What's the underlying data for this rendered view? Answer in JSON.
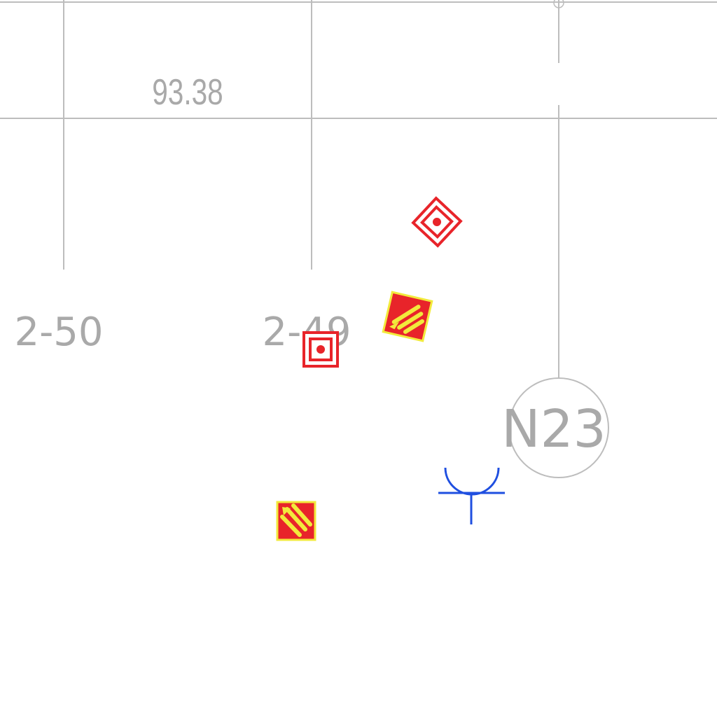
{
  "map": {
    "colors": {
      "background": "#ffffff",
      "grid_line": "#bdbdbd",
      "label_text": "#a9a9a9",
      "symbol_red": "#e8242a",
      "symbol_yellow": "#f2ea3c",
      "symbol_blue": "#1f4fe0"
    },
    "labels": {
      "elevation": "93.38",
      "parcel_left": "2-50",
      "parcel_center": "2-49",
      "node_id": "N23"
    },
    "symbols": [
      {
        "name": "red-concentric-diamond-icon",
        "kind": "target-diamond"
      },
      {
        "name": "red-concentric-square-icon",
        "kind": "target-square"
      },
      {
        "name": "red-yellow-hatched-square-icon",
        "kind": "hatched-square"
      },
      {
        "name": "red-yellow-hatched-square-icon",
        "kind": "hatched-square"
      },
      {
        "name": "blue-antenna-symbol-icon",
        "kind": "antenna"
      }
    ]
  }
}
